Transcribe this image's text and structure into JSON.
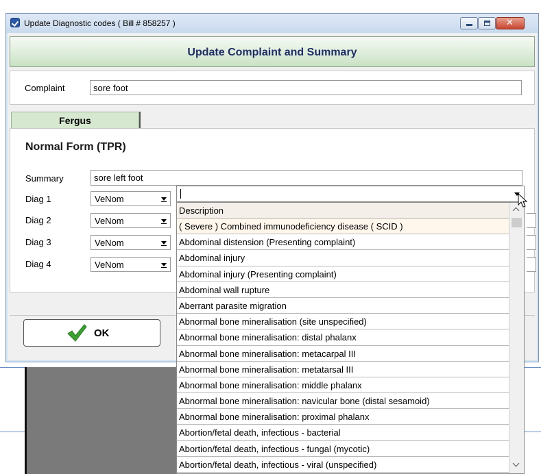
{
  "window": {
    "title": "Update Diagnostic codes ( Bill # 858257 )"
  },
  "header": {
    "title": "Update Complaint and Summary"
  },
  "complaint": {
    "label": "Complaint",
    "value": "sore foot"
  },
  "tabs": [
    {
      "label": "Fergus"
    }
  ],
  "form": {
    "title": "Normal Form (TPR)",
    "summary_label": "Summary",
    "summary_value": "sore left foot",
    "diags": [
      {
        "label": "Diag 1",
        "code_system": "VeNom"
      },
      {
        "label": "Diag 2",
        "code_system": "VeNom"
      },
      {
        "label": "Diag 3",
        "code_system": "VeNom"
      },
      {
        "label": "Diag 4",
        "code_system": "VeNom"
      }
    ]
  },
  "ok_button": {
    "label": "OK"
  },
  "description_dropdown": {
    "header": "Description",
    "input_value": "",
    "items": [
      "( Severe ) Combined immunodeficiency disease ( SCID )",
      "Abdominal distension (Presenting complaint)",
      "Abdominal injury",
      "Abdominal injury (Presenting complaint)",
      "Abdominal wall rupture",
      "Aberrant parasite migration",
      "Abnormal bone mineralisation (site unspecified)",
      "Abnormal bone mineralisation: distal phalanx",
      "Abnormal bone mineralisation: metacarpal III",
      "Abnormal bone mineralisation: metatarsal III",
      "Abnormal bone mineralisation: middle phalanx",
      "Abnormal bone mineralisation: navicular bone (distal sesamoid)",
      "Abnormal bone mineralisation: proximal phalanx",
      "Abortion/fetal death, infectious - bacterial",
      "Abortion/fetal death, infectious - fungal (mycotic)",
      "Abortion/fetal death, infectious - viral (unspecified)"
    ]
  },
  "colors": {
    "header_text": "#1f2d66",
    "tab_bg": "#d6e8cf",
    "ok_check": "#3aa12f"
  }
}
